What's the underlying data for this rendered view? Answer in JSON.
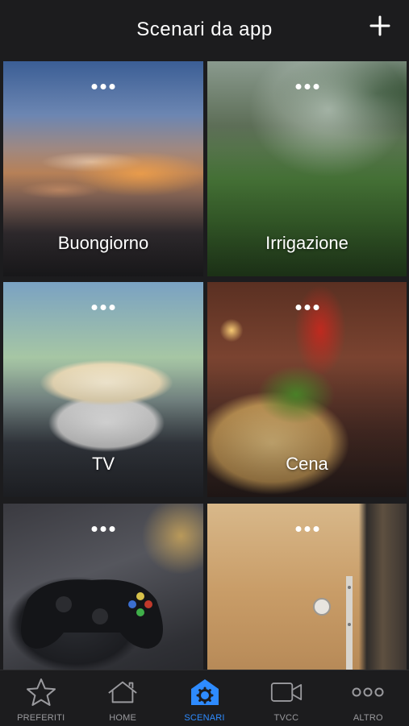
{
  "header": {
    "title": "Scenari da app",
    "add_icon": "plus-icon"
  },
  "scenes": [
    {
      "label": "Buongiorno",
      "more_icon": "more-dots-icon",
      "image": "sunrise-sky"
    },
    {
      "label": "Irrigazione",
      "more_icon": "more-dots-icon",
      "image": "lawn-sprinkler"
    },
    {
      "label": "TV",
      "more_icon": "more-dots-icon",
      "image": "popcorn-bowl"
    },
    {
      "label": "Cena",
      "more_icon": "more-dots-icon",
      "image": "pasta-and-wine"
    },
    {
      "label": "",
      "more_icon": "more-dots-icon",
      "image": "game-controller"
    },
    {
      "label": "",
      "more_icon": "more-dots-icon",
      "image": "wooden-door"
    }
  ],
  "tabbar": {
    "active_color": "#2e8bff",
    "inactive_color": "#9a9a9e",
    "tabs": [
      {
        "label": "PREFERITI",
        "icon": "star-icon",
        "active": false
      },
      {
        "label": "HOME",
        "icon": "house-icon",
        "active": false
      },
      {
        "label": "SCENARI",
        "icon": "gear-house-icon",
        "active": true
      },
      {
        "label": "TVCC",
        "icon": "video-camera-icon",
        "active": false
      },
      {
        "label": "ALTRO",
        "icon": "more-dots-icon",
        "active": false
      }
    ]
  }
}
